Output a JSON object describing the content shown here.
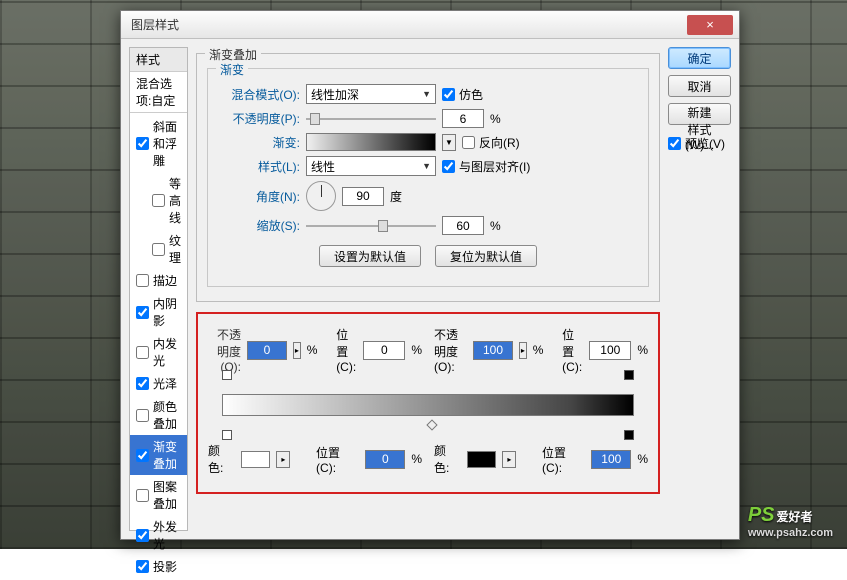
{
  "dialog": {
    "title": "图层样式",
    "close": "×"
  },
  "styles": {
    "head": "样式",
    "sub": "混合选项:自定",
    "items": [
      {
        "label": "斜面和浮雕",
        "checked": true,
        "indent": false
      },
      {
        "label": "等高线",
        "checked": false,
        "indent": true
      },
      {
        "label": "纹理",
        "checked": false,
        "indent": true
      },
      {
        "label": "描边",
        "checked": false,
        "indent": false
      },
      {
        "label": "内阴影",
        "checked": true,
        "indent": false
      },
      {
        "label": "内发光",
        "checked": false,
        "indent": false
      },
      {
        "label": "光泽",
        "checked": true,
        "indent": false
      },
      {
        "label": "颜色叠加",
        "checked": false,
        "indent": false
      },
      {
        "label": "渐变叠加",
        "checked": true,
        "indent": false,
        "selected": true
      },
      {
        "label": "图案叠加",
        "checked": false,
        "indent": false
      },
      {
        "label": "外发光",
        "checked": true,
        "indent": false
      },
      {
        "label": "投影",
        "checked": true,
        "indent": false
      }
    ]
  },
  "main": {
    "group_title": "渐变叠加",
    "inner_title": "渐变",
    "blend_label": "混合模式(O):",
    "blend_value": "线性加深",
    "dither_label": "仿色",
    "opacity_label": "不透明度(P):",
    "opacity_value": "6",
    "pct": "%",
    "gradient_label": "渐变:",
    "reverse_label": "反向(R)",
    "style_label": "样式(L):",
    "style_value": "线性",
    "align_label": "与图层对齐(I)",
    "angle_label": "角度(N):",
    "angle_value": "90",
    "angle_unit": "度",
    "scale_label": "缩放(S):",
    "scale_value": "60",
    "defaults_btn": "设置为默认值",
    "reset_btn": "复位为默认值"
  },
  "buttons": {
    "ok": "确定",
    "cancel": "取消",
    "newstyle": "新建样式(W)...",
    "preview_label": "预览(V)"
  },
  "editor": {
    "opacity_left_label": "不透明度(O):",
    "opacity_left_value": "0",
    "pos_left_label": "位置(C):",
    "pos_left_value": "0",
    "opacity_right_label": "不透明度(O):",
    "opacity_right_value": "100",
    "pos_right_label": "位置(C):",
    "pos_right_value": "100",
    "color_label_l": "颜色:",
    "color_pos_l_label": "位置(C):",
    "color_pos_l_value": "0",
    "color_label_r": "颜色:",
    "color_pos_r_label": "位置(C):",
    "color_pos_r_value": "100",
    "pct": "%",
    "color_l": "#ffffff",
    "color_r": "#000000"
  },
  "watermark": {
    "brand": "PS",
    "text": "爱好者",
    "url": "www.psahz.com"
  }
}
